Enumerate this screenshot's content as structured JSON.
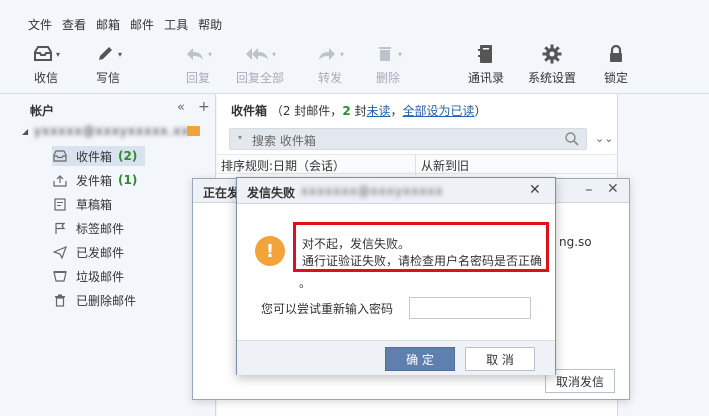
{
  "menu": [
    "文件",
    "查看",
    "邮箱",
    "邮件",
    "工具",
    "帮助"
  ],
  "toolbar": {
    "receive": "收信",
    "compose": "写信",
    "reply": "回复",
    "reply_all": "回复全部",
    "forward": "转发",
    "delete": "删除",
    "contacts": "通讯录",
    "settings": "系统设置",
    "lock": "锁定"
  },
  "sidebar": {
    "header": "帐户",
    "collapse": "«",
    "add": "+",
    "account_name": "yxxxxx@xxxyxxxxx.xx",
    "folders": [
      {
        "name": "收件箱",
        "count": "(2)"
      },
      {
        "name": "发件箱",
        "count": "(1)"
      },
      {
        "name": "草稿箱",
        "count": ""
      },
      {
        "name": "标签邮件",
        "count": ""
      },
      {
        "name": "已发邮件",
        "count": ""
      },
      {
        "name": "垃圾邮件",
        "count": ""
      },
      {
        "name": "已删除邮件",
        "count": ""
      }
    ]
  },
  "list": {
    "title": "收件箱",
    "open_paren": "（",
    "total": "2 封邮件，",
    "unread_count": "2",
    "unread_pre": " 封",
    "unread_link": "未读",
    "comma": "，",
    "mark_all_read": "全部设为已读",
    "close_paren": "）",
    "search_placeholder": "搜索 收件箱",
    "sort_rule": "排序规则:日期（会话）",
    "sort_order": "从新到旧"
  },
  "send_dialog": {
    "title": "正在发",
    "fragment": "ng.so",
    "cancel_send": "取消发信"
  },
  "fail_dialog": {
    "title": "发信失败",
    "blurred": "xxxxxxx@xxxyxxxxx",
    "message_1": "对不起，发信失败。",
    "message_2": "通行证验证失败，请检查用户名密码是否正确",
    "message_tail": "。",
    "retry_label": "您可以尝试重新输入密码",
    "password_value": "",
    "ok": "确 定",
    "cancel": "取 消"
  },
  "colors": {
    "accent": "#5f7fae",
    "warning": "#f2a33a",
    "highlight_border": "#e0101a",
    "count_green": "#2e8b2e",
    "link": "#2563a8"
  }
}
